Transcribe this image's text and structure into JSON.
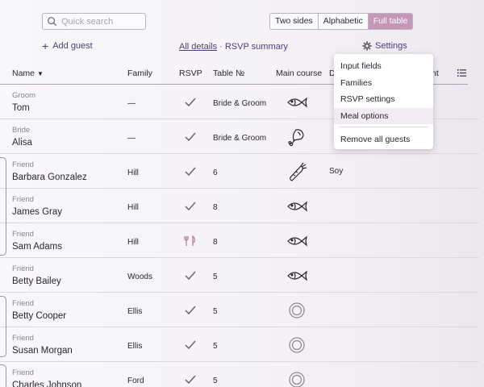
{
  "search": {
    "placeholder": "Quick search"
  },
  "view_toggle": {
    "options": [
      "Two sides",
      "Alphabetic",
      "Full table"
    ],
    "active": "Full table"
  },
  "toolbar": {
    "add_guest": "Add guest",
    "all_details": "All details",
    "separator": " · ",
    "rsvp_summary": "RSVP summary",
    "settings": "Settings"
  },
  "columns": {
    "name": "Name",
    "family": "Family",
    "rsvp": "RSVP",
    "table": "Table №",
    "main_course": "Main course",
    "diet_partial": "D",
    "comment_partial": "nt"
  },
  "settings_menu": {
    "items": [
      "Input fields",
      "Families",
      "RSVP settings",
      "Meal options"
    ],
    "remove_all": "Remove all guests",
    "highlighted": "Meal options"
  },
  "guests": [
    {
      "relation": "Groom",
      "name": "Tom",
      "family": "—",
      "rsvp": "check",
      "table": "Bride & Groom",
      "meal": "fish-icon",
      "diet": ""
    },
    {
      "relation": "Bride",
      "name": "Alisa",
      "family": "—",
      "rsvp": "check",
      "table": "Bride & Groom",
      "meal": "meat-icon",
      "diet": ""
    },
    {
      "relation": "Friend",
      "name": "Barbara Gonzalez",
      "family": "Hill",
      "rsvp": "check",
      "table": "6",
      "meal": "carrot-icon",
      "diet": "Soy"
    },
    {
      "relation": "Friend",
      "name": "James Gray",
      "family": "Hill",
      "rsvp": "check",
      "table": "8",
      "meal": "fish-icon",
      "diet": ""
    },
    {
      "relation": "Friend",
      "name": "Sam Adams",
      "family": "Hill",
      "rsvp": "fork-knife",
      "table": "8",
      "meal": "fish-icon",
      "diet": ""
    },
    {
      "relation": "Friend",
      "name": "Betty Bailey",
      "family": "Woods",
      "rsvp": "check",
      "table": "5",
      "meal": "fish-icon",
      "diet": ""
    },
    {
      "relation": "Friend",
      "name": "Betty Cooper",
      "family": "Ellis",
      "rsvp": "check",
      "table": "5",
      "meal": "plate-icon",
      "diet": ""
    },
    {
      "relation": "Friend",
      "name": "Susan Morgan",
      "family": "Ellis",
      "rsvp": "check",
      "table": "5",
      "meal": "plate-icon",
      "diet": ""
    },
    {
      "relation": "Friend",
      "name": "Charles Johnson",
      "family": "Ford",
      "rsvp": "check",
      "table": "5",
      "meal": "plate-icon",
      "diet": ""
    }
  ],
  "colors": {
    "accent": "#c496b7",
    "link": "#4d3b7e",
    "text": "#2a2530",
    "muted": "#88838d"
  }
}
